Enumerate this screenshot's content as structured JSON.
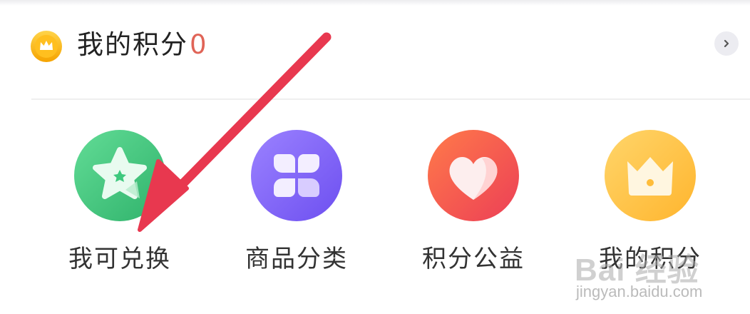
{
  "points_header": {
    "icon": "crown-coin-icon",
    "title": "我的积分",
    "value": "0",
    "chevron_icon": "chevron-right-icon"
  },
  "colors": {
    "points_value": "#e06457",
    "arrow": "#e8384f",
    "green": "#3ec97e",
    "purple": "#8a6cf5",
    "red": "#f0584a",
    "yellow": "#ffc53d"
  },
  "menu": {
    "items": [
      {
        "label": "我可兑换",
        "icon": "star-icon"
      },
      {
        "label": "商品分类",
        "icon": "four-petal-clover-icon"
      },
      {
        "label": "积分公益",
        "icon": "heart-icon"
      },
      {
        "label": "我的积分",
        "icon": "crown-icon"
      }
    ]
  },
  "watermark": {
    "main": "Bai 经验",
    "sub": "jingyan.baidu.com"
  }
}
